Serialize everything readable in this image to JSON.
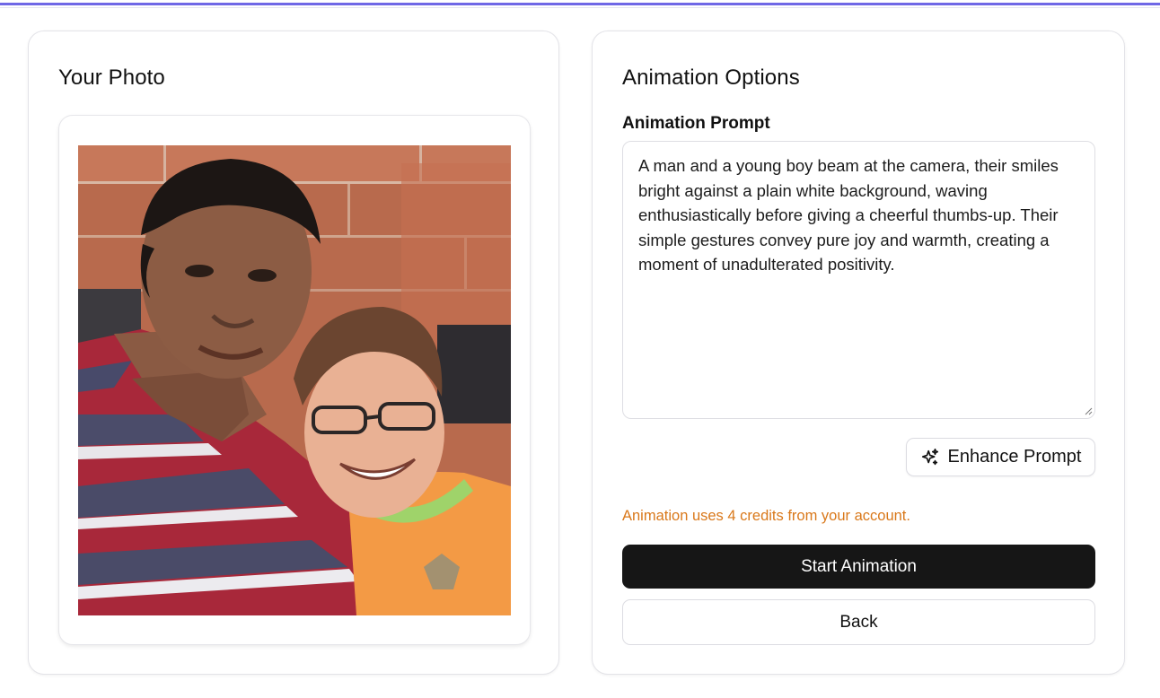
{
  "colors": {
    "accent_line": "#6f67e6",
    "primary_button": "#161616",
    "warning_text": "#d9781a"
  },
  "photo_card": {
    "title": "Your Photo",
    "image_icon": "photo-of-man-and-boy"
  },
  "options_card": {
    "title": "Animation Options",
    "prompt_label": "Animation Prompt",
    "prompt_value": "A man and a young boy beam at the camera, their smiles bright against a plain white background, waving enthusiastically before giving a cheerful thumbs-up. Their simple gestures convey pure joy and warmth, creating a moment of unadulterated positivity.",
    "enhance_button": {
      "icon": "sparkles-icon",
      "label": "Enhance Prompt"
    },
    "credits_note": "Animation uses 4 credits from your account.",
    "start_button": "Start Animation",
    "back_button": "Back"
  }
}
